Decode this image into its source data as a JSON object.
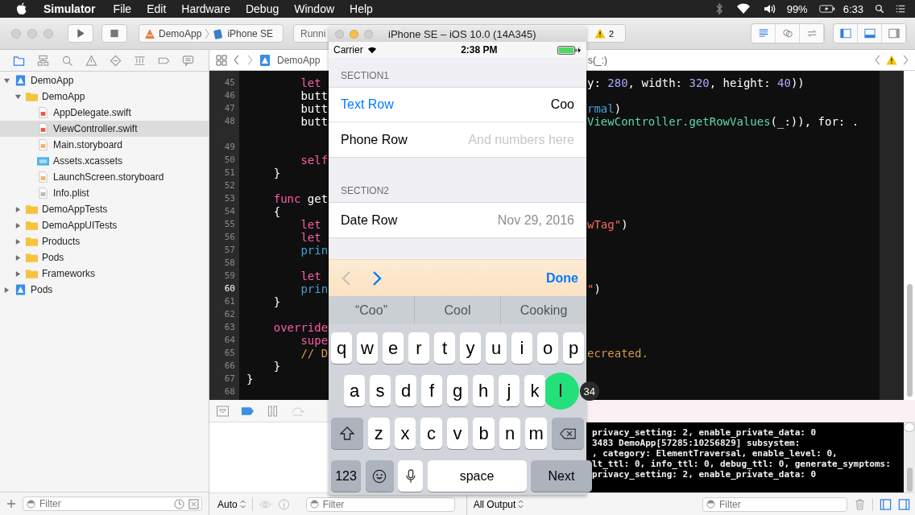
{
  "menu_bar": {
    "app": "Simulator",
    "items": [
      "File",
      "Edit",
      "Hardware",
      "Debug",
      "Window",
      "Help"
    ],
    "battery": "99%",
    "time": "6:33"
  },
  "toolbar": {
    "scheme": "DemoApp",
    "device": "iPhone SE",
    "activity": "Runni",
    "warnings": "2"
  },
  "navigator": {
    "tabs": [
      {
        "selected": true
      },
      {
        "selected": false
      },
      {
        "selected": false
      },
      {
        "selected": false
      },
      {
        "selected": false
      },
      {
        "selected": false
      },
      {
        "selected": false
      },
      {
        "selected": false
      }
    ],
    "tree": [
      {
        "name": "DemoApp",
        "kind": "project",
        "expanded": true,
        "selected": false,
        "children": [
          {
            "name": "DemoApp",
            "kind": "folder",
            "expanded": true,
            "selected": false,
            "children": [
              {
                "name": "AppDelegate.swift",
                "kind": "swift",
                "selected": false
              },
              {
                "name": "ViewController.swift",
                "kind": "swift",
                "selected": true
              },
              {
                "name": "Main.storyboard",
                "kind": "storyboard",
                "selected": false
              },
              {
                "name": "Assets.xcassets",
                "kind": "assets",
                "selected": false
              },
              {
                "name": "LaunchScreen.storyboard",
                "kind": "storyboard",
                "selected": false
              },
              {
                "name": "Info.plist",
                "kind": "plist",
                "selected": false
              }
            ]
          },
          {
            "name": "DemoAppTests",
            "kind": "folder",
            "expanded": false,
            "selected": false
          },
          {
            "name": "DemoAppUITests",
            "kind": "folder",
            "expanded": false,
            "selected": false
          },
          {
            "name": "Products",
            "kind": "folder",
            "expanded": false,
            "selected": false
          },
          {
            "name": "Pods",
            "kind": "folder",
            "expanded": false,
            "selected": false
          },
          {
            "name": "Frameworks",
            "kind": "folder",
            "expanded": false,
            "selected": false
          }
        ]
      },
      {
        "name": "Pods",
        "kind": "project",
        "expanded": false,
        "selected": false
      }
    ],
    "filter": {
      "placeholder": "Filter"
    }
  },
  "editor": {
    "crumb": "DemoApp",
    "symbol": "s(_:)",
    "lines": [
      {
        "num": "45",
        "current": false,
        "wrapped": false,
        "left": [
          {
            "text": "        let",
            "kind": "keyword"
          }
        ],
        "right": [
          {
            "text": "y: ",
            "kind": "plain"
          },
          {
            "text": "280",
            "kind": "number"
          },
          {
            "text": ", width: ",
            "kind": "plain"
          },
          {
            "text": "320",
            "kind": "number"
          },
          {
            "text": ", height: ",
            "kind": "plain"
          },
          {
            "text": "40",
            "kind": "number"
          },
          {
            "text": "))",
            "kind": "plain"
          }
        ]
      },
      {
        "num": "46",
        "current": false,
        "wrapped": false,
        "left": [
          {
            "text": "        butt",
            "kind": "plain"
          }
        ]
      },
      {
        "num": "47",
        "current": false,
        "wrapped": false,
        "left": [
          {
            "text": "        butt",
            "kind": "plain"
          }
        ],
        "right": [
          {
            "text": "rmal",
            "kind": "call"
          },
          {
            "text": ")",
            "kind": "plain"
          }
        ]
      },
      {
        "num": "48",
        "current": false,
        "wrapped": true,
        "left": [
          {
            "text": "        butt",
            "kind": "plain"
          }
        ],
        "right": [
          {
            "text": "ViewController.getRowValues",
            "kind": "type"
          },
          {
            "text": "(_:)), for: .",
            "kind": "plain"
          }
        ]
      },
      {
        "num": "49",
        "current": false,
        "wrapped": false
      },
      {
        "num": "50",
        "current": false,
        "wrapped": false,
        "left": [
          {
            "text": "        self",
            "kind": "keyword"
          }
        ]
      },
      {
        "num": "51",
        "current": false,
        "wrapped": false,
        "left": [
          {
            "text": "    }",
            "kind": "plain"
          }
        ]
      },
      {
        "num": "52",
        "current": false,
        "wrapped": false
      },
      {
        "num": "53",
        "current": false,
        "wrapped": false,
        "left": [
          {
            "text": "    func",
            "kind": "keyword"
          },
          {
            "text": " get",
            "kind": "plain"
          }
        ]
      },
      {
        "num": "54",
        "current": false,
        "wrapped": false,
        "left": [
          {
            "text": "    {",
            "kind": "plain"
          }
        ]
      },
      {
        "num": "55",
        "current": false,
        "wrapped": false,
        "left": [
          {
            "text": "        let",
            "kind": "keyword"
          }
        ],
        "right": [
          {
            "text": "wTag\"",
            "kind": "string"
          },
          {
            "text": ")",
            "kind": "plain"
          }
        ]
      },
      {
        "num": "56",
        "current": false,
        "wrapped": false,
        "left": [
          {
            "text": "        let",
            "kind": "keyword"
          }
        ]
      },
      {
        "num": "57",
        "current": false,
        "wrapped": false,
        "left": [
          {
            "text": "        prin",
            "kind": "call"
          }
        ]
      },
      {
        "num": "58",
        "current": false,
        "wrapped": false
      },
      {
        "num": "59",
        "current": false,
        "wrapped": false,
        "left": [
          {
            "text": "        let",
            "kind": "keyword"
          }
        ]
      },
      {
        "num": "60",
        "current": true,
        "wrapped": false,
        "left": [
          {
            "text": "        prin",
            "kind": "call"
          }
        ],
        "right": [
          {
            "text": "\"",
            "kind": "string"
          },
          {
            "text": ")",
            "kind": "plain"
          }
        ]
      },
      {
        "num": "61",
        "current": false,
        "wrapped": false,
        "left": [
          {
            "text": "    }",
            "kind": "plain"
          }
        ]
      },
      {
        "num": "62",
        "current": false,
        "wrapped": false
      },
      {
        "num": "63",
        "current": false,
        "wrapped": false,
        "left": [
          {
            "text": "    override",
            "kind": "keyword"
          }
        ]
      },
      {
        "num": "64",
        "current": false,
        "wrapped": false,
        "left": [
          {
            "text": "        supe",
            "kind": "keyword"
          }
        ]
      },
      {
        "num": "65",
        "current": false,
        "wrapped": false,
        "left": [
          {
            "text": "        // D",
            "kind": "comment"
          }
        ],
        "right": [
          {
            "text": "ecreated.",
            "kind": "comment"
          }
        ]
      },
      {
        "num": "66",
        "current": false,
        "wrapped": false,
        "left": [
          {
            "text": "    }",
            "kind": "plain"
          }
        ]
      },
      {
        "num": "67",
        "current": false,
        "wrapped": false,
        "left": [
          {
            "text": "}",
            "kind": "plain"
          }
        ]
      },
      {
        "num": "68",
        "current": false,
        "wrapped": false
      }
    ]
  },
  "debug": {
    "variables_mode": "Auto",
    "variables_filter": {
      "placeholder": "Filter"
    },
    "output_mode": "All Output",
    "console_filter": {
      "placeholder": "Filter"
    },
    "console_lines": [
      "privacy_setting: 2, enable_private_data: 0",
      "3483 DemoApp[57285:10256829] subsystem:",
      ", category: ElementTraversal, enable_level: 0,",
      "lt_ttl: 0, info_ttl: 0, debug_ttl: 0, generate_symptoms:",
      "privacy_setting: 2, enable_private_data: 0"
    ]
  },
  "simulator": {
    "title": "iPhone SE – iOS 10.0 (14A345)",
    "carrier": "Carrier",
    "time": "2:38 PM",
    "sections": [
      {
        "header": "SECTION1",
        "rows": [
          {
            "label": "Text Row",
            "kind": "text-field",
            "value": "Coo",
            "focused": true
          },
          {
            "label": "Phone Row",
            "kind": "text-field",
            "placeholder": "And numbers here",
            "focused": false
          }
        ]
      },
      {
        "header": "SECTION2",
        "rows": [
          {
            "label": "Date Row",
            "kind": "date",
            "value": "Nov 29, 2016",
            "focused": false
          }
        ]
      }
    ],
    "accessory": {
      "previous_disabled": true,
      "next_disabled": false,
      "done": "Done"
    },
    "suggestions": [
      "“Coo”",
      "Cool",
      "Cooking"
    ],
    "keyboard": {
      "touch_count": "34",
      "rows": [
        {
          "keys": [
            {
              "kind": "letter",
              "label": "q",
              "touched": false
            },
            {
              "kind": "letter",
              "label": "w",
              "touched": false
            },
            {
              "kind": "letter",
              "label": "e",
              "touched": false
            },
            {
              "kind": "letter",
              "label": "r",
              "touched": false
            },
            {
              "kind": "letter",
              "label": "t",
              "touched": false
            },
            {
              "kind": "letter",
              "label": "y",
              "touched": false
            },
            {
              "kind": "letter",
              "label": "u",
              "touched": false
            },
            {
              "kind": "letter",
              "label": "i",
              "touched": false
            },
            {
              "kind": "letter",
              "label": "o",
              "touched": false
            },
            {
              "kind": "letter",
              "label": "p",
              "touched": false
            }
          ]
        },
        {
          "keys": [
            {
              "kind": "letter",
              "label": "a",
              "touched": false
            },
            {
              "kind": "letter",
              "label": "s",
              "touched": false
            },
            {
              "kind": "letter",
              "label": "d",
              "touched": false
            },
            {
              "kind": "letter",
              "label": "f",
              "touched": false
            },
            {
              "kind": "letter",
              "label": "g",
              "touched": false
            },
            {
              "kind": "letter",
              "label": "h",
              "touched": false
            },
            {
              "kind": "letter",
              "label": "j",
              "touched": false
            },
            {
              "kind": "letter",
              "label": "k",
              "touched": false
            },
            {
              "kind": "letter",
              "label": "l",
              "touched": true
            }
          ]
        },
        {
          "keys": [
            {
              "kind": "shift",
              "touched": false
            },
            {
              "kind": "letter",
              "label": "z",
              "touched": false
            },
            {
              "kind": "letter",
              "label": "x",
              "touched": false
            },
            {
              "kind": "letter",
              "label": "c",
              "touched": false
            },
            {
              "kind": "letter",
              "label": "v",
              "touched": false
            },
            {
              "kind": "letter",
              "label": "b",
              "touched": false
            },
            {
              "kind": "letter",
              "label": "n",
              "touched": false
            },
            {
              "kind": "letter",
              "label": "m",
              "touched": false
            },
            {
              "kind": "delete",
              "touched": false
            }
          ]
        },
        {
          "keys": [
            {
              "kind": "mode",
              "label": "123",
              "touched": false
            },
            {
              "kind": "emoji",
              "touched": false
            },
            {
              "kind": "mic",
              "touched": false
            },
            {
              "kind": "space",
              "label": "space",
              "touched": false
            },
            {
              "kind": "return",
              "label": "Next",
              "touched": false
            }
          ]
        }
      ]
    }
  }
}
